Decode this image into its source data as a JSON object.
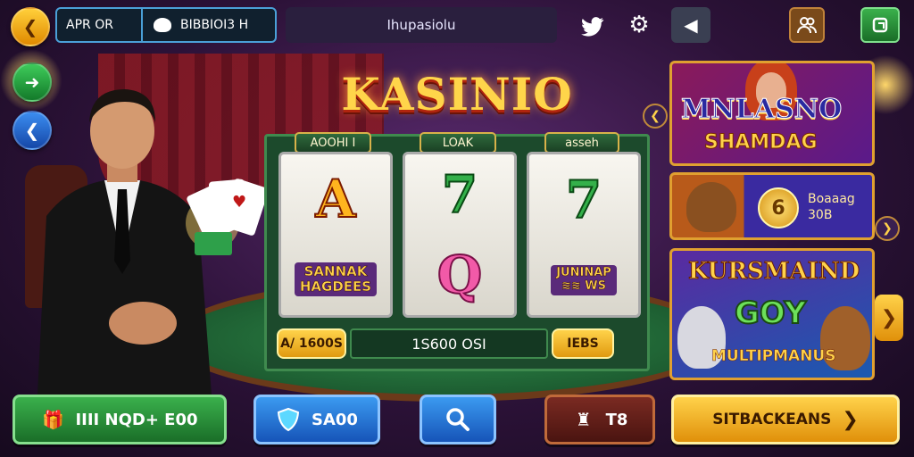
{
  "colors": {
    "background": "#2c1238",
    "accent_gold": "#ffd24a",
    "accent_green": "#3ab04c",
    "accent_blue": "#3b9af0"
  },
  "top_bar": {
    "back_icon": "chevron-left-icon",
    "balance_label": "APR OR",
    "piggy_icon": "piggy-bank-icon",
    "currency_text": "BIBBIOI3 H",
    "title": "Ihupasiolu",
    "twitter_icon": "twitter-icon",
    "settings_icon": "gear-icon",
    "sound_icon": "speaker-icon",
    "profile_icon": "users-icon",
    "exit_icon": "exit-icon"
  },
  "left_nav": {
    "forward_icon": "arrow-right-icon",
    "back_icon": "arrow-left-icon"
  },
  "logo": {
    "text": "KASINIO"
  },
  "slot": {
    "reel_tabs": [
      "AOOHI I",
      "LOAK",
      "asseh"
    ],
    "reels": [
      {
        "symbol": "A",
        "label": "SANNAK\nHAGDEES"
      },
      {
        "symbol": "7",
        "symbol2": "Q"
      },
      {
        "symbol": "7",
        "label": "JUNINAP\n≋≋ WS"
      }
    ],
    "left_pill": "A/ 1600S",
    "win_display": "1S600 OSI",
    "right_pill": "IEBS"
  },
  "side_cards": {
    "card1_line1": "MNLASNO",
    "card1_line2": "SHAMDAG",
    "card2_coin": "6",
    "card2_text": "Boaaag\n30B",
    "card3_line1": "KURSMAIND",
    "card3_line2": "GOY",
    "card3_line3": "MULTIPMANUS"
  },
  "bottom_bar": {
    "green_label": "IIII NQD+ E00",
    "blue_label": "SA00",
    "search_icon": "search-icon",
    "brown_label": "T8",
    "gold_label": "SITBACKEANS"
  }
}
